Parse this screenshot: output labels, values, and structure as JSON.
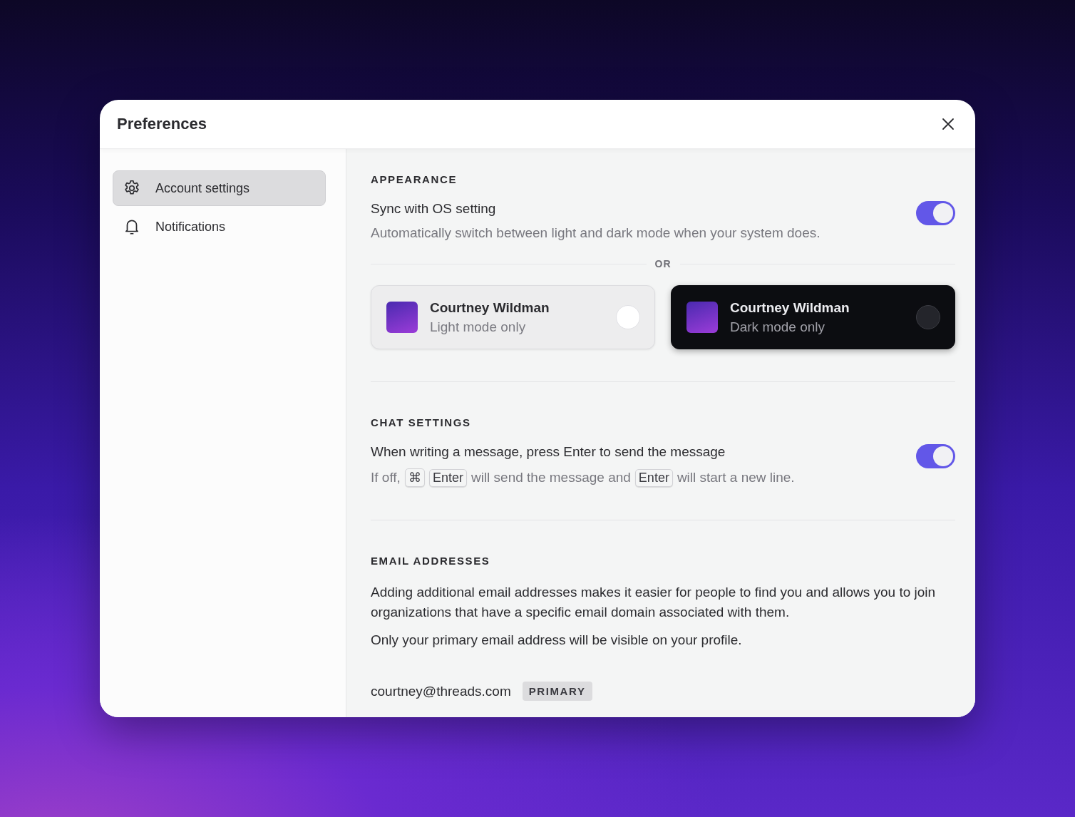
{
  "window": {
    "title": "Preferences"
  },
  "sidebar": {
    "items": [
      {
        "kind": "gear",
        "label": "Account settings",
        "selected": true
      },
      {
        "kind": "bell",
        "label": "Notifications",
        "selected": false
      }
    ]
  },
  "appearance": {
    "heading": "APPEARANCE",
    "sync": {
      "title": "Sync with OS setting",
      "description": "Automatically switch between light and dark mode when your system does.",
      "on": true
    },
    "separator": "OR",
    "themes": [
      {
        "kind": "light",
        "name": "Courtney Wildman",
        "mode": "Light mode only",
        "selected": false
      },
      {
        "kind": "dark",
        "name": "Courtney Wildman",
        "mode": "Dark mode only",
        "selected": false
      }
    ]
  },
  "chat_settings": {
    "heading": "CHAT SETTINGS",
    "enter_to_send": {
      "title": "When writing a message, press Enter to send the message",
      "on": true,
      "hint": [
        {
          "kind": "text",
          "text": "If off,"
        },
        {
          "kind": "key",
          "text": "⌘"
        },
        {
          "kind": "key",
          "text": "Enter"
        },
        {
          "kind": "text",
          "text": "will send the message and"
        },
        {
          "kind": "key",
          "text": "Enter"
        },
        {
          "kind": "text",
          "text": "will start a new line."
        }
      ]
    }
  },
  "email_addresses": {
    "heading": "EMAIL ADDRESSES",
    "paragraphs": [
      "Adding additional email addresses makes it easier for people to find you and allows you to join organizations that have a specific email domain associated with them.",
      "Only your primary email address will be visible on your profile."
    ],
    "addresses": [
      {
        "address": "courtney@threads.com",
        "badge": "PRIMARY"
      }
    ]
  }
}
